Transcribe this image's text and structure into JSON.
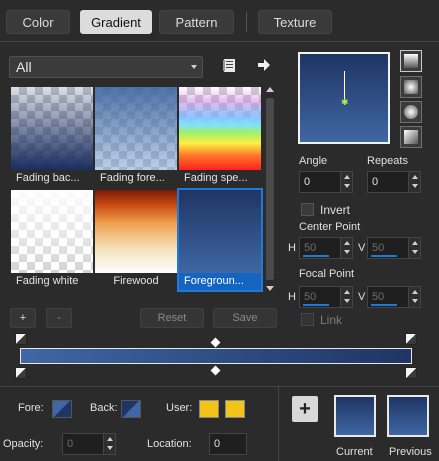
{
  "tabs": [
    {
      "label": "Color"
    },
    {
      "label": "Gradient"
    },
    {
      "label": "Pattern"
    },
    {
      "label": "Texture"
    }
  ],
  "category": {
    "value": "All"
  },
  "gradients": [
    {
      "label": "Fading bac..."
    },
    {
      "label": "Fading fore..."
    },
    {
      "label": "Fading spe..."
    },
    {
      "label": "Fading white"
    },
    {
      "label": "Firewood"
    },
    {
      "label": "Foregroun..."
    }
  ],
  "actions": {
    "add": "+",
    "remove": "-",
    "reset": "Reset",
    "save": "Save"
  },
  "controls": {
    "angle_label": "Angle",
    "angle_value": "0",
    "repeats_label": "Repeats",
    "repeats_value": "0",
    "invert_label": "Invert",
    "center_label": "Center Point",
    "focal_label": "Focal Point",
    "h_label": "H",
    "v_label": "V",
    "center_h": "50",
    "center_v": "50",
    "focal_h": "50",
    "focal_v": "50",
    "link_label": "Link"
  },
  "stops": {
    "fore_label": "Fore:",
    "back_label": "Back:",
    "user_label": "User:",
    "opacity_label": "Opacity:",
    "opacity_value": "0",
    "location_label": "Location:",
    "location_value": "0"
  },
  "result": {
    "add": "+",
    "current_label": "Current",
    "previous_label": "Previous"
  },
  "colors": {
    "gradient_start": "#3f67a3",
    "gradient_end": "#1f3564",
    "accent": "#1e7ad6",
    "user_color": "#f2c318"
  }
}
